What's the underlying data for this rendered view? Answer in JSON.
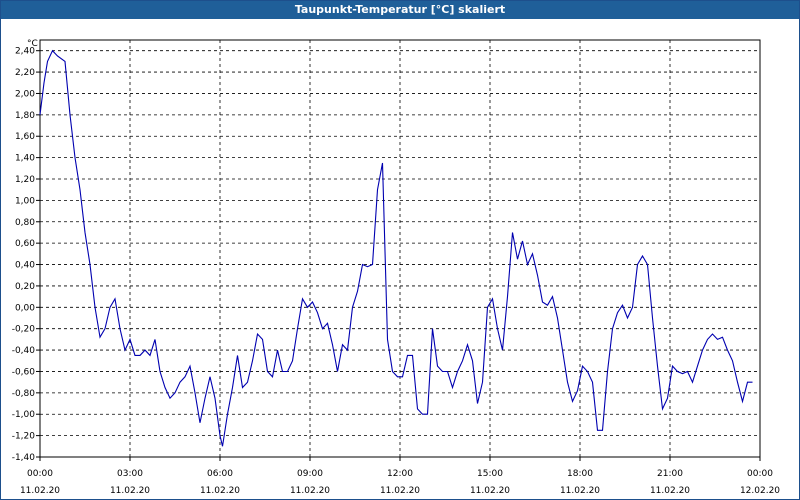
{
  "window": {
    "title": "Taupunkt-Temperatur [°C] skaliert"
  },
  "colors": {
    "titlebar": "#1f5f99",
    "line": "#0000b0",
    "grid": "#000000"
  },
  "chart_data": {
    "type": "line",
    "title": "Taupunkt-Temperatur [°C] skaliert",
    "ylabel": "°C",
    "ylim": [
      -1.4,
      2.5
    ],
    "xlim": [
      "2020-02-11T00:00",
      "2020-02-12T00:00"
    ],
    "grid": true,
    "y_ticks": [
      "2,40",
      "2,20",
      "2,00",
      "1,80",
      "1,60",
      "1,40",
      "1,20",
      "1,00",
      "0,80",
      "0,60",
      "0,40",
      "0,20",
      "0,00",
      "-0,20",
      "-0,40",
      "-0,60",
      "-0,80",
      "-1,00",
      "-1,20",
      "-1,40"
    ],
    "x_ticks": [
      {
        "time": "00:00",
        "date": "11.02.20"
      },
      {
        "time": "03:00",
        "date": "11.02.20"
      },
      {
        "time": "06:00",
        "date": "11.02.20"
      },
      {
        "time": "09:00",
        "date": "11.02.20"
      },
      {
        "time": "12:00",
        "date": "11.02.20"
      },
      {
        "time": "15:00",
        "date": "11.02.20"
      },
      {
        "time": "18:00",
        "date": "11.02.20"
      },
      {
        "time": "21:00",
        "date": "11.02.20"
      },
      {
        "time": "00:00",
        "date": "12.02.20"
      }
    ],
    "series": [
      {
        "points": [
          [
            "00:00",
            1.8
          ],
          [
            "00:08",
            2.1
          ],
          [
            "00:15",
            2.3
          ],
          [
            "00:25",
            2.4
          ],
          [
            "00:35",
            2.35
          ],
          [
            "00:50",
            2.3
          ],
          [
            "01:00",
            1.8
          ],
          [
            "01:10",
            1.4
          ],
          [
            "01:20",
            1.1
          ],
          [
            "01:30",
            0.7
          ],
          [
            "01:40",
            0.4
          ],
          [
            "01:50",
            0.0
          ],
          [
            "02:00",
            -0.28
          ],
          [
            "02:10",
            -0.2
          ],
          [
            "02:20",
            0.0
          ],
          [
            "02:30",
            0.08
          ],
          [
            "02:40",
            -0.2
          ],
          [
            "02:50",
            -0.4
          ],
          [
            "03:00",
            -0.3
          ],
          [
            "03:10",
            -0.45
          ],
          [
            "03:20",
            -0.45
          ],
          [
            "03:30",
            -0.4
          ],
          [
            "03:40",
            -0.45
          ],
          [
            "03:50",
            -0.3
          ],
          [
            "04:00",
            -0.6
          ],
          [
            "04:10",
            -0.75
          ],
          [
            "04:20",
            -0.85
          ],
          [
            "04:30",
            -0.8
          ],
          [
            "04:40",
            -0.7
          ],
          [
            "04:50",
            -0.65
          ],
          [
            "05:00",
            -0.55
          ],
          [
            "05:10",
            -0.8
          ],
          [
            "05:20",
            -1.08
          ],
          [
            "05:30",
            -0.85
          ],
          [
            "05:40",
            -0.65
          ],
          [
            "05:50",
            -0.85
          ],
          [
            "06:00",
            -1.2
          ],
          [
            "06:05",
            -1.3
          ],
          [
            "06:15",
            -1.0
          ],
          [
            "06:25",
            -0.75
          ],
          [
            "06:35",
            -0.45
          ],
          [
            "06:45",
            -0.75
          ],
          [
            "06:55",
            -0.7
          ],
          [
            "07:05",
            -0.5
          ],
          [
            "07:15",
            -0.25
          ],
          [
            "07:25",
            -0.3
          ],
          [
            "07:35",
            -0.6
          ],
          [
            "07:45",
            -0.65
          ],
          [
            "07:55",
            -0.4
          ],
          [
            "08:05",
            -0.6
          ],
          [
            "08:15",
            -0.6
          ],
          [
            "08:25",
            -0.5
          ],
          [
            "08:35",
            -0.2
          ],
          [
            "08:45",
            0.08
          ],
          [
            "08:55",
            0.0
          ],
          [
            "09:05",
            0.05
          ],
          [
            "09:15",
            -0.05
          ],
          [
            "09:25",
            -0.2
          ],
          [
            "09:35",
            -0.15
          ],
          [
            "09:45",
            -0.35
          ],
          [
            "09:55",
            -0.6
          ],
          [
            "10:05",
            -0.35
          ],
          [
            "10:15",
            -0.4
          ],
          [
            "10:25",
            0.0
          ],
          [
            "10:35",
            0.15
          ],
          [
            "10:45",
            0.4
          ],
          [
            "10:55",
            0.38
          ],
          [
            "11:05",
            0.4
          ],
          [
            "11:15",
            1.1
          ],
          [
            "11:25",
            1.35
          ],
          [
            "11:35",
            -0.3
          ],
          [
            "11:45",
            -0.6
          ],
          [
            "11:55",
            -0.65
          ],
          [
            "12:05",
            -0.65
          ],
          [
            "12:15",
            -0.45
          ],
          [
            "12:25",
            -0.45
          ],
          [
            "12:35",
            -0.95
          ],
          [
            "12:45",
            -1.0
          ],
          [
            "12:55",
            -1.0
          ],
          [
            "13:05",
            -0.2
          ],
          [
            "13:15",
            -0.55
          ],
          [
            "13:25",
            -0.6
          ],
          [
            "13:35",
            -0.6
          ],
          [
            "13:45",
            -0.75
          ],
          [
            "13:55",
            -0.6
          ],
          [
            "14:05",
            -0.5
          ],
          [
            "14:15",
            -0.35
          ],
          [
            "14:25",
            -0.5
          ],
          [
            "14:35",
            -0.9
          ],
          [
            "14:45",
            -0.7
          ],
          [
            "14:55",
            0.0
          ],
          [
            "15:05",
            0.08
          ],
          [
            "15:15",
            -0.2
          ],
          [
            "15:25",
            -0.4
          ],
          [
            "15:35",
            0.1
          ],
          [
            "15:45",
            0.7
          ],
          [
            "15:55",
            0.45
          ],
          [
            "16:05",
            0.62
          ],
          [
            "16:15",
            0.4
          ],
          [
            "16:25",
            0.5
          ],
          [
            "16:35",
            0.3
          ],
          [
            "16:45",
            0.05
          ],
          [
            "16:55",
            0.02
          ],
          [
            "17:05",
            0.1
          ],
          [
            "17:15",
            -0.1
          ],
          [
            "17:25",
            -0.4
          ],
          [
            "17:35",
            -0.7
          ],
          [
            "17:45",
            -0.88
          ],
          [
            "17:55",
            -0.78
          ],
          [
            "18:05",
            -0.55
          ],
          [
            "18:15",
            -0.6
          ],
          [
            "18:25",
            -0.7
          ],
          [
            "18:35",
            -1.15
          ],
          [
            "18:45",
            -1.15
          ],
          [
            "18:55",
            -0.6
          ],
          [
            "19:05",
            -0.2
          ],
          [
            "19:15",
            -0.05
          ],
          [
            "19:25",
            0.02
          ],
          [
            "19:35",
            -0.1
          ],
          [
            "19:45",
            0.0
          ],
          [
            "19:55",
            0.4
          ],
          [
            "20:05",
            0.48
          ],
          [
            "20:15",
            0.4
          ],
          [
            "20:25",
            -0.1
          ],
          [
            "20:35",
            -0.55
          ],
          [
            "20:45",
            -0.95
          ],
          [
            "20:55",
            -0.85
          ],
          [
            "21:05",
            -0.55
          ],
          [
            "21:15",
            -0.6
          ],
          [
            "21:25",
            -0.62
          ],
          [
            "21:35",
            -0.6
          ],
          [
            "21:45",
            -0.7
          ],
          [
            "21:55",
            -0.55
          ],
          [
            "22:05",
            -0.4
          ],
          [
            "22:15",
            -0.3
          ],
          [
            "22:25",
            -0.25
          ],
          [
            "22:35",
            -0.3
          ],
          [
            "22:45",
            -0.28
          ],
          [
            "22:55",
            -0.4
          ],
          [
            "23:05",
            -0.5
          ],
          [
            "23:15",
            -0.7
          ],
          [
            "23:25",
            -0.88
          ],
          [
            "23:35",
            -0.7
          ],
          [
            "23:45",
            -0.7
          ]
        ]
      }
    ]
  }
}
